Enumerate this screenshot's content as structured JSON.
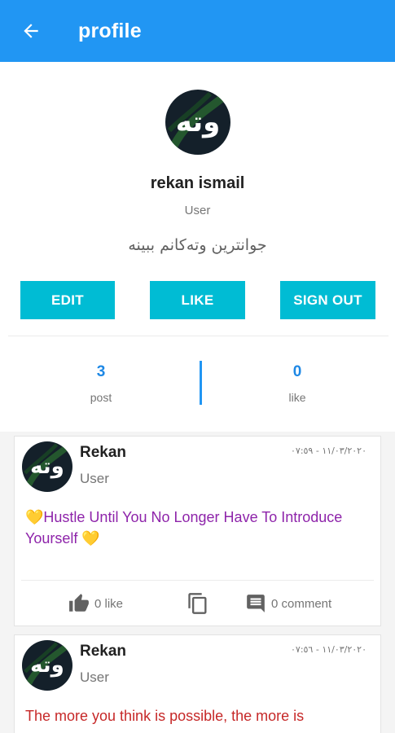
{
  "appbar": {
    "title": "profile"
  },
  "profile": {
    "logo_text": "وته",
    "name": "rekan ismail",
    "role": "User",
    "bio": "جوانترین وتەکانم ببینە"
  },
  "buttons": {
    "edit": "EDIT",
    "like": "LIKE",
    "sign_out": "SIGN OUT"
  },
  "stats": {
    "posts": {
      "value": "3",
      "label": "post"
    },
    "likes": {
      "value": "0",
      "label": "like"
    }
  },
  "posts": [
    {
      "author": "Rekan",
      "role": "User",
      "date": "١١/٠٣/٢٠٢٠ - ٠٧:٥٩",
      "text": "💛Hustle Until You No Longer Have To Introduce Yourself 💛",
      "like_label": "0 like",
      "comment_label": "0 comment",
      "text_color": "#8e24aa"
    },
    {
      "author": "Rekan",
      "role": "User",
      "date": "١١/٠٣/٢٠٢٠ - ٠٧:٥٦",
      "text": "The more you think is possible, the more is",
      "text_color": "#c62828"
    }
  ],
  "colors": {
    "appbar": "#2196f3",
    "button": "#00bcd4",
    "stat_number": "#1e88e5"
  },
  "icons": [
    "arrow-back-icon",
    "thumb-up-icon",
    "copy-icon",
    "comment-icon"
  ]
}
